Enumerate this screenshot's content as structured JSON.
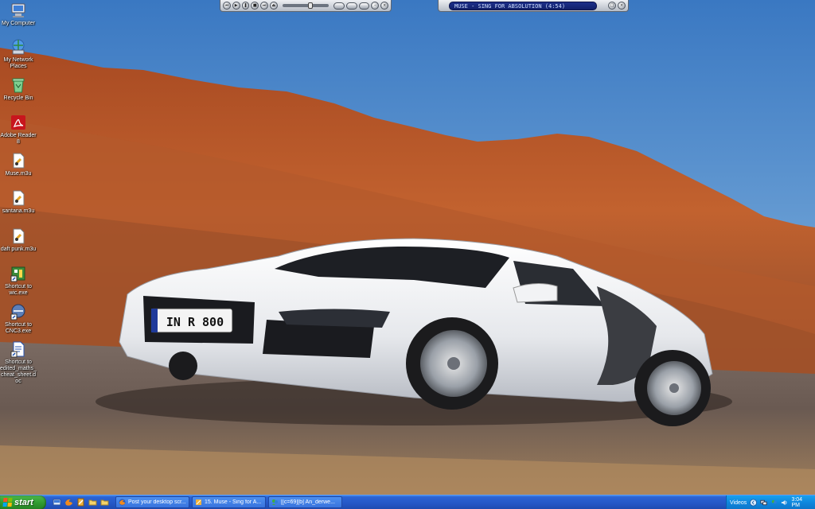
{
  "desktop": {
    "icons": [
      {
        "label": "My Computer",
        "icon": "my-computer-icon"
      },
      {
        "label": "My Network Places",
        "icon": "network-places-icon"
      },
      {
        "label": "Recycle Bin",
        "icon": "recycle-bin-icon"
      },
      {
        "label": "Adobe Reader 8",
        "icon": "adobe-reader-icon"
      },
      {
        "label": "Muse.m3u",
        "icon": "playlist-file-icon"
      },
      {
        "label": "santana.m3u",
        "icon": "playlist-file-icon"
      },
      {
        "label": "daft punk.m3u",
        "icon": "playlist-file-icon"
      },
      {
        "label": "Shortcut to wic.exe",
        "icon": "app-shortcut-icon"
      },
      {
        "label": "Shortcut to CNC3.exe",
        "icon": "game-shortcut-icon"
      },
      {
        "label": "Shortcut to edited_maths_cheat_sheet.doc",
        "icon": "document-shortcut-icon"
      }
    ],
    "plate_text": "IN R 800"
  },
  "player": {
    "now_playing": "MUSE - SING FOR ABSOLUTION (4:54)",
    "controls": [
      "previous",
      "play",
      "pause",
      "stop",
      "next"
    ]
  },
  "taskbar": {
    "start_label": "start",
    "quicklaunch": [
      "show-desktop-icon",
      "firefox-icon",
      "winamp-icon",
      "folder-icon",
      "folder-icon"
    ],
    "tasks": [
      {
        "label": "Post your desktop scr...",
        "icon": "firefox-icon"
      },
      {
        "label": "15. Muse - Sing for A...",
        "icon": "winamp-icon"
      },
      {
        "label": "[[c=69][b] An_derwe...",
        "icon": "messenger-icon"
      }
    ],
    "tray": {
      "label": "Videos",
      "time": "3:04 PM"
    }
  },
  "colors": {
    "taskbar_blue": "#2457c6",
    "start_green": "#2f9a2f",
    "tray_blue": "#0f86dd",
    "sky": "#3e7fc4",
    "rock": "#b4552a"
  }
}
